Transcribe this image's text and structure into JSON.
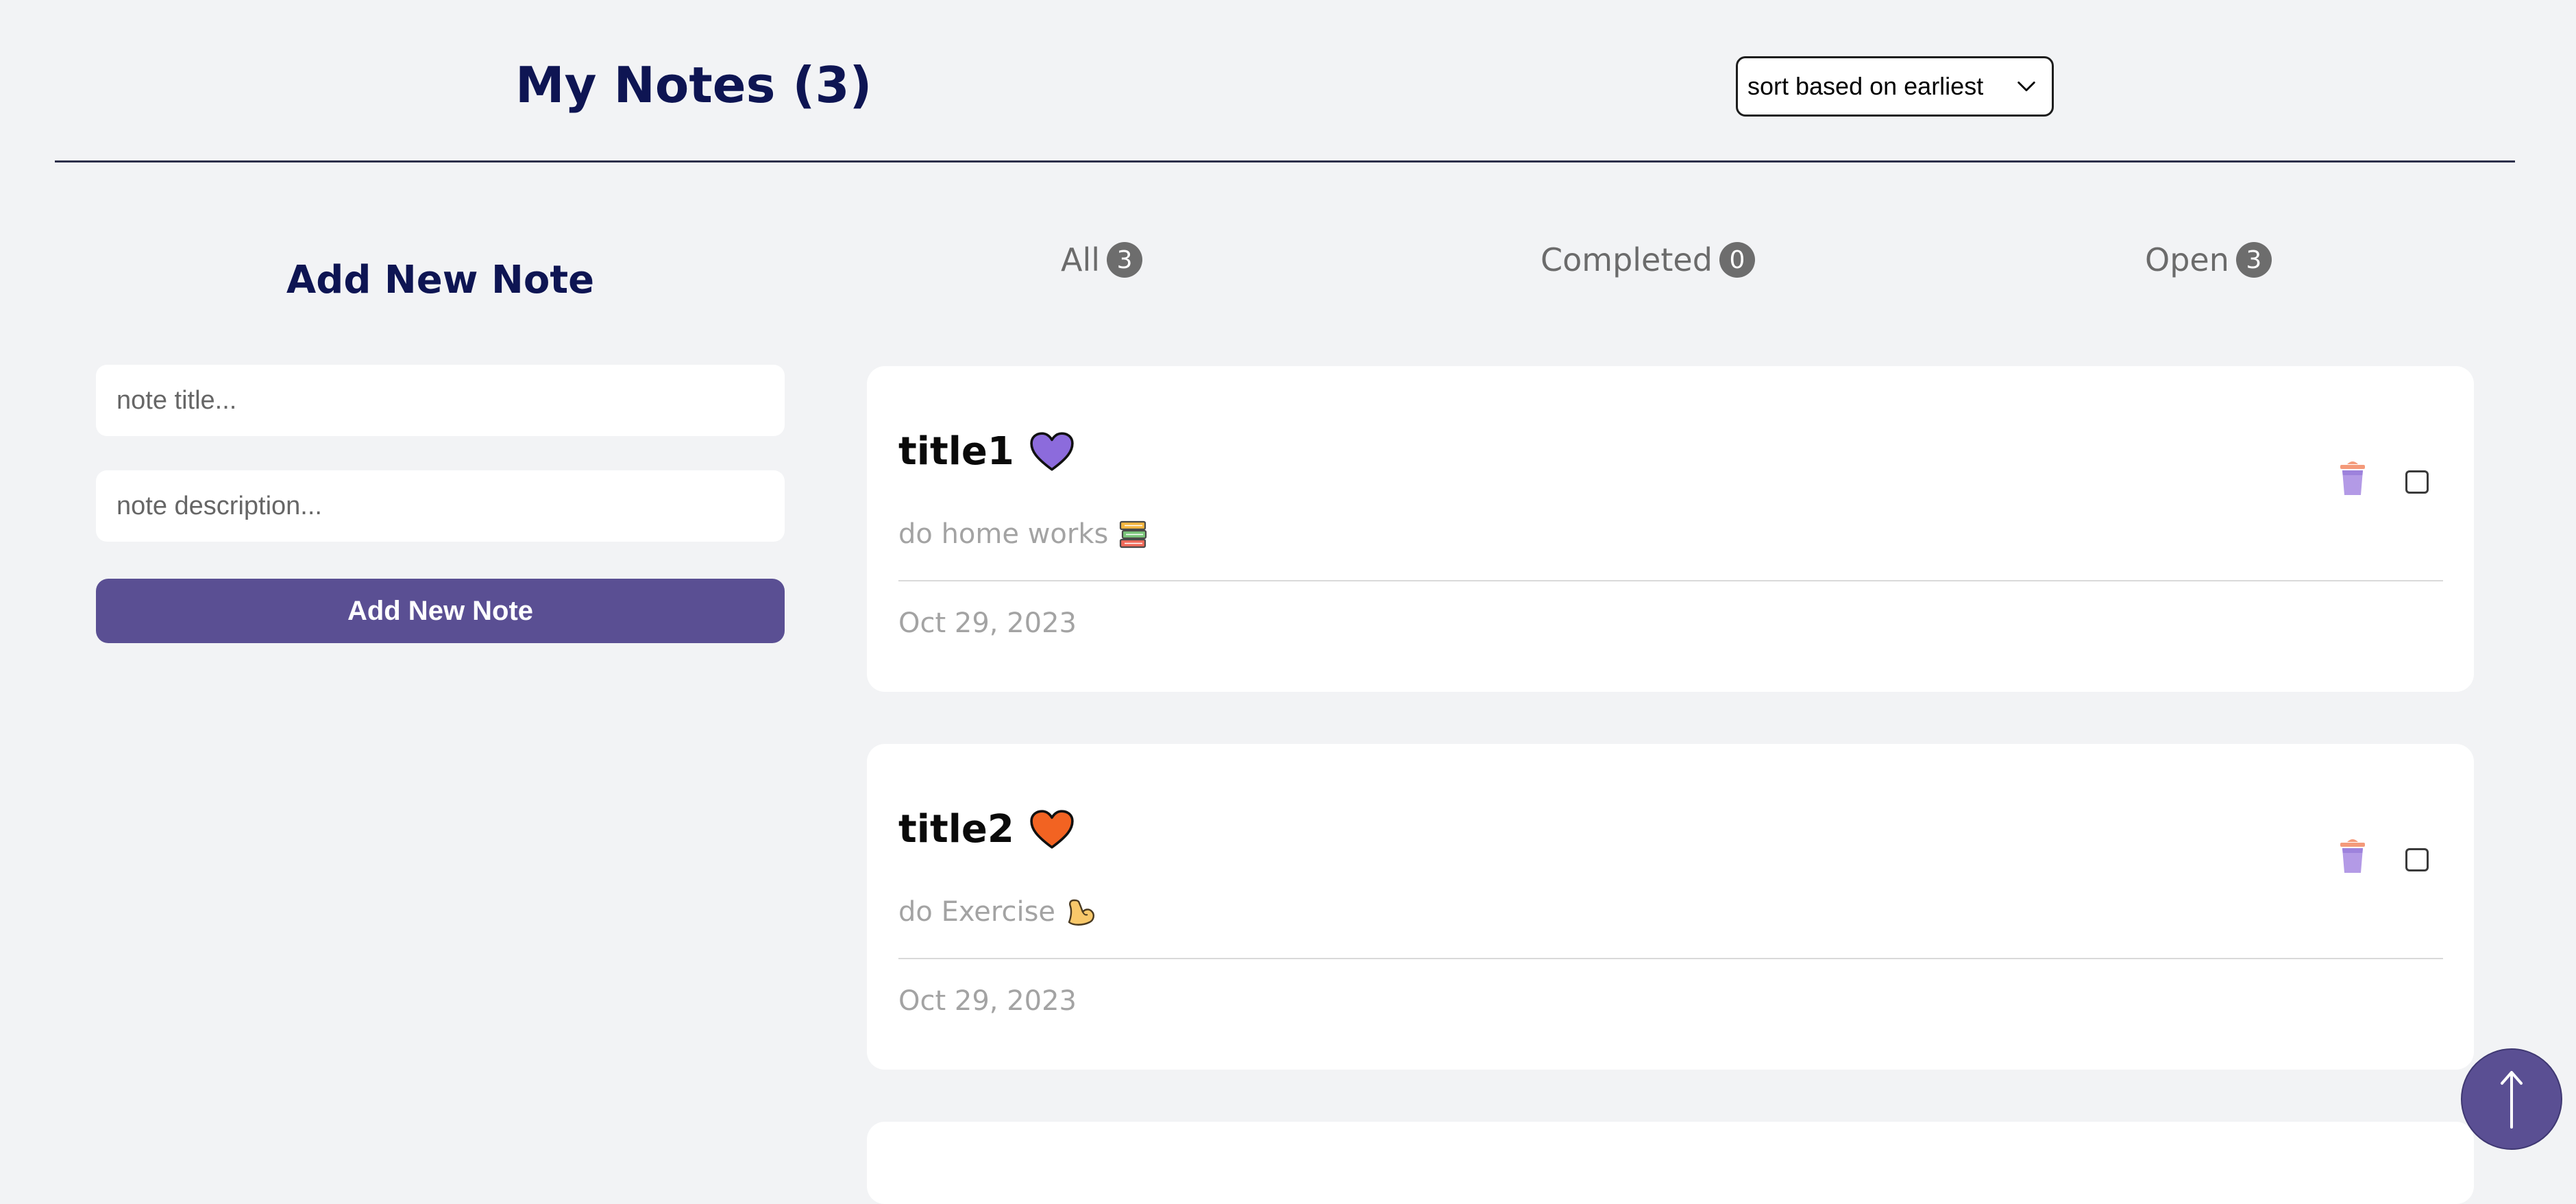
{
  "header": {
    "title": "My Notes (3)",
    "sort": {
      "selected": "sort based on earliest",
      "icon": "chevron-down-icon"
    }
  },
  "form": {
    "heading": "Add New Note",
    "title_placeholder": "note title...",
    "description_placeholder": "note description...",
    "submit_label": "Add New Note",
    "accent_color": "#5a4f93"
  },
  "tabs": [
    {
      "label": "All",
      "count": "3"
    },
    {
      "label": "Completed",
      "count": "0"
    },
    {
      "label": "Open",
      "count": "3"
    }
  ],
  "notes": [
    {
      "title": "title1",
      "heart_color": "#8c6bdc",
      "heart_icon": "purple-heart-icon",
      "description": "do home works",
      "description_icon": "books-icon",
      "date": "Oct 29, 2023",
      "completed": false
    },
    {
      "title": "title2",
      "heart_color": "#f26322",
      "heart_icon": "orange-heart-icon",
      "description": "do Exercise",
      "description_icon": "flexed-biceps-icon",
      "date": "Oct 29, 2023",
      "completed": false
    }
  ],
  "scroll_top": {
    "icon": "arrow-up-icon"
  }
}
